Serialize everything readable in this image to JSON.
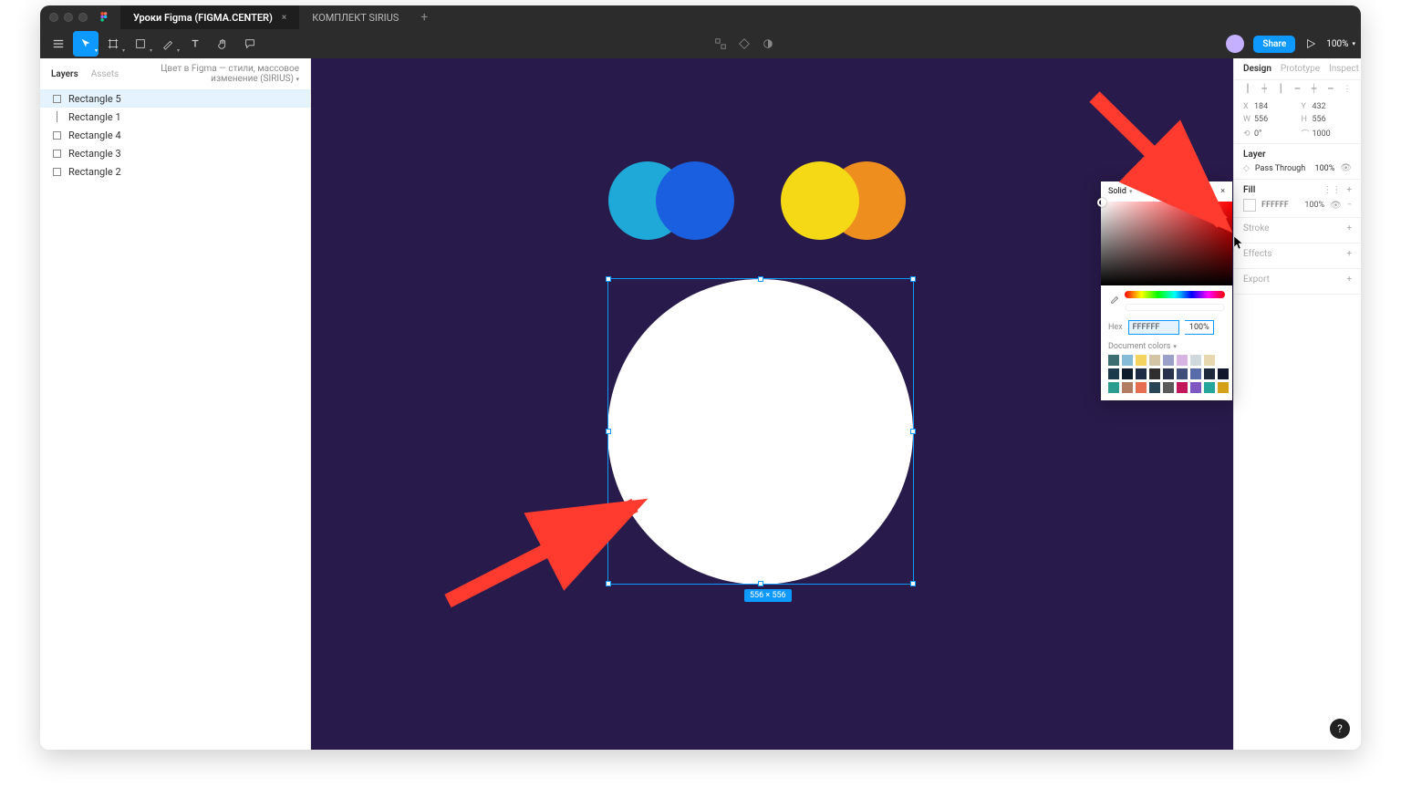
{
  "tabs": {
    "active": "Уроки Figma (FIGMA.CENTER)",
    "inactive": "КОМПЛЕКТ SIRIUS"
  },
  "toolbar": {
    "zoom": "100%",
    "share": "Share"
  },
  "left_panel": {
    "layers_tab": "Layers",
    "assets_tab": "Assets",
    "page_name": "Цвет в Figma — стили, массовое изменение (SIRIUS)",
    "layers": [
      {
        "name": "Rectangle 5",
        "selected": true,
        "shape": "rect"
      },
      {
        "name": "Rectangle 1",
        "selected": false,
        "shape": "line"
      },
      {
        "name": "Rectangle 4",
        "selected": false,
        "shape": "rect"
      },
      {
        "name": "Rectangle 3",
        "selected": false,
        "shape": "rect"
      },
      {
        "name": "Rectangle 2",
        "selected": false,
        "shape": "rect"
      }
    ]
  },
  "canvas": {
    "dim_badge": "556 × 556"
  },
  "right_panel": {
    "tabs": {
      "design": "Design",
      "prototype": "Prototype",
      "inspect": "Inspect"
    },
    "x": "184",
    "y": "432",
    "w": "556",
    "h": "556",
    "rot": "0°",
    "radius": "1000",
    "layer_title": "Layer",
    "blend": "Pass Through",
    "opacity": "100%",
    "fill_title": "Fill",
    "fill_hex": "FFFFFF",
    "fill_pct": "100%",
    "stroke_title": "Stroke",
    "effects_title": "Effects",
    "export_title": "Export"
  },
  "picker": {
    "mode": "Solid",
    "hex_label": "Hex",
    "hex_value": "FFFFFF",
    "hex_pct": "100%",
    "doc_title": "Document colors",
    "palette": [
      "#3c6e71",
      "#86bbd8",
      "#f4d35e",
      "#d4c4a6",
      "#9aa0c7",
      "#d8b4e2",
      "#cfd8dc",
      "#e8d8b0",
      "#ffffff",
      "#1b3a4b",
      "#0d1b2a",
      "#1f2a44",
      "#2f2f2f",
      "#28304b",
      "#404e7c",
      "#576ca8",
      "#1e293b",
      "#0f172a",
      "#2a9d8f",
      "#b07d62",
      "#e76f51",
      "#264653",
      "#5a5a5a",
      "#c2185b",
      "#7e57c2",
      "#26a69a",
      "#d4a017"
    ]
  }
}
